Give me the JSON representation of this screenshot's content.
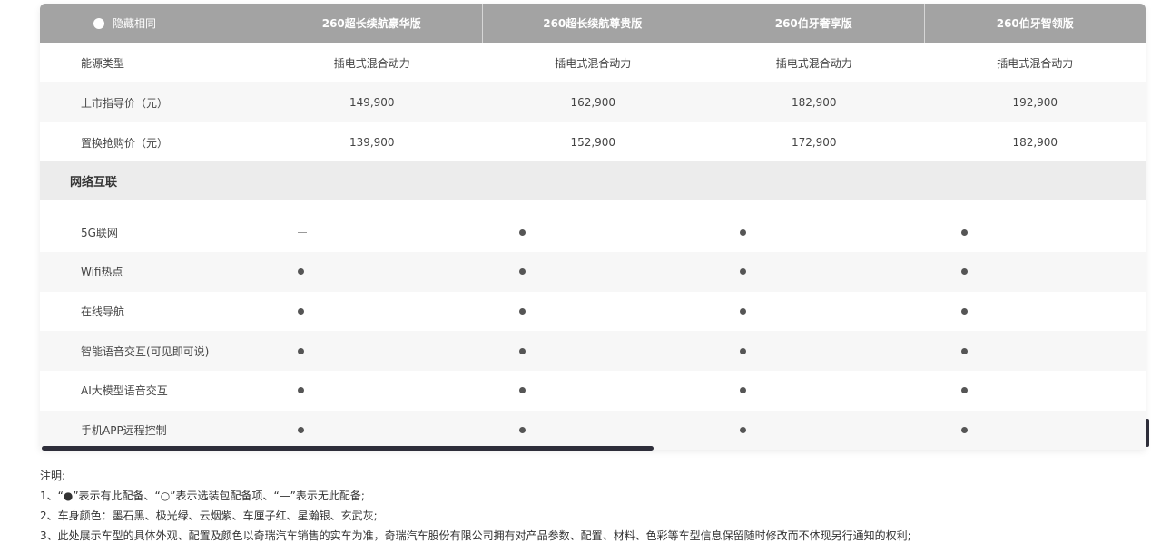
{
  "header": {
    "toggle_label": "隐藏相同",
    "columns": [
      "260超长续航豪华版",
      "260超长续航尊贵版",
      "260伯牙奢享版",
      "260伯牙智领版"
    ]
  },
  "rows_basic": [
    {
      "label": "能源类型",
      "values": [
        "插电式混合动力",
        "插电式混合动力",
        "插电式混合动力",
        "插电式混合动力"
      ]
    },
    {
      "label": "上市指导价（元）",
      "values": [
        "149,900",
        "162,900",
        "182,900",
        "192,900"
      ]
    },
    {
      "label": "置换抢购价（元）",
      "values": [
        "139,900",
        "152,900",
        "172,900",
        "182,900"
      ]
    }
  ],
  "section": {
    "title": "网络互联"
  },
  "rows_features": [
    {
      "label": "5G联网",
      "marks": [
        "dash",
        "dot",
        "dot",
        "dot"
      ]
    },
    {
      "label": "Wifi热点",
      "marks": [
        "dot",
        "dot",
        "dot",
        "dot"
      ]
    },
    {
      "label": "在线导航",
      "marks": [
        "dot",
        "dot",
        "dot",
        "dot"
      ]
    },
    {
      "label": "智能语音交互(可见即可说)",
      "marks": [
        "dot",
        "dot",
        "dot",
        "dot"
      ]
    },
    {
      "label": "AI大模型语音交互",
      "marks": [
        "dot",
        "dot",
        "dot",
        "dot"
      ]
    },
    {
      "label": "手机APP远程控制",
      "marks": [
        "dot",
        "dot",
        "dot",
        "dot"
      ]
    }
  ],
  "notes": {
    "title": "注明:",
    "lines": [
      "1、“●”表示有此配备、“○”表示选装包配备项、“—”表示无此配备;",
      "2、车身颜色：墨石黑、极光绿、云烟紫、车厘子红、星瀚银、玄武灰;",
      "3、此处展示车型的具体外观、配置及颜色以奇瑞汽车销售的实车为准，奇瑞汽车股份有限公司拥有对产品参数、配置、材料、色彩等车型信息保留随时修改而不体现另行通知的权利;"
    ]
  },
  "colors": {
    "header_bg": "#a3a3a3",
    "section_bg": "#ececec",
    "scrollbar": "#2e2e3a"
  }
}
